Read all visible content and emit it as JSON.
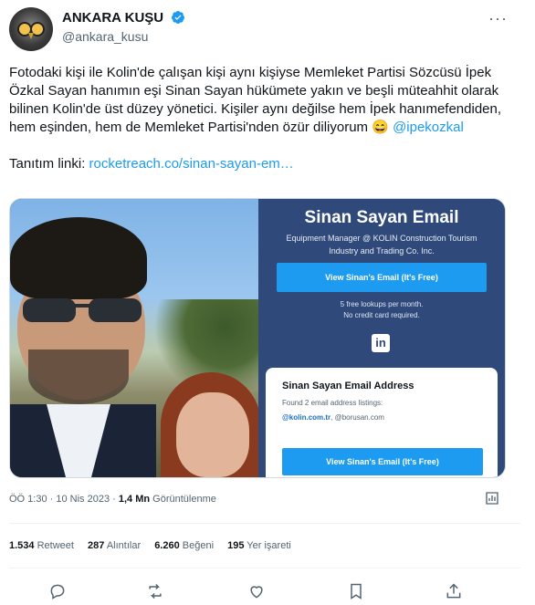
{
  "author": {
    "display_name": "ANKARA KUŞU",
    "handle": "@ankara_kusu"
  },
  "more_icon": "more-icon",
  "tweet": {
    "text_main": "Fotodaki kişi ile Kolin'de çalışan kişi aynı kişiyse Memleket Partisi Sözcüsü İpek Özkal Sayan hanımın eşi Sinan Sayan hükümete yakın ve beşli müteahhit olarak bilinen Kolin'de üst düzey yönetici. Kişiler aynı değilse hem İpek hanımefendiden, hem eşinden, hem de Memleket Partisi'nden özür diliyorum 😄 ",
    "mention": "@ipekozkal",
    "link_label": "Tanıtım linki: ",
    "link": "rocketreach.co/sinan-sayan-em…"
  },
  "card": {
    "title": "Sinan Sayan Email",
    "subtitle": "Equipment Manager @ KOLIN Construction Tourism Industry and Trading Co. Inc.",
    "button": "View Sinan's Email (It's Free)",
    "note_1": "5 free lookups per month.",
    "note_2": "No credit card required.",
    "linkedin": "in",
    "panel_title": "Sinan Sayan Email Address",
    "panel_found": "Found 2 email address listings:",
    "panel_email_1": "@kolin.com.tr",
    "panel_email_2": ", @borusan.com",
    "panel_button": "View Sinan's Email (It's Free)"
  },
  "meta": {
    "time": "ÖÖ 1:30",
    "sep": " · ",
    "date": "10 Nis 2023",
    "views_count": "1,4 Mn",
    "views_label": " Görüntülenme"
  },
  "stats": [
    {
      "num": "1.534",
      "label": " Retweet"
    },
    {
      "num": "287",
      "label": " Alıntılar"
    },
    {
      "num": "6.260",
      "label": " Beğeni"
    },
    {
      "num": "195",
      "label": " Yer işareti"
    }
  ],
  "colors": {
    "accent": "#1d9bf0",
    "card_bg": "#2f4a7a"
  }
}
